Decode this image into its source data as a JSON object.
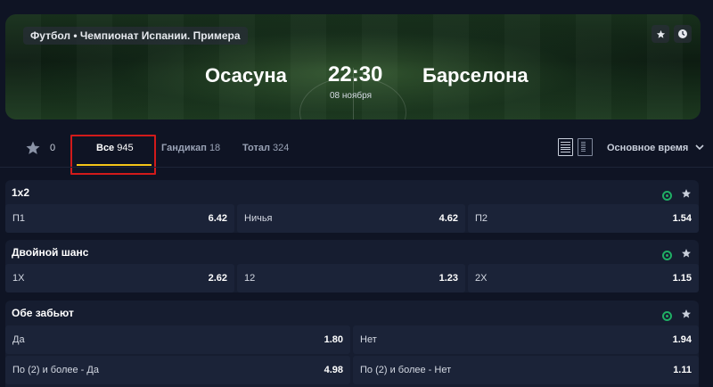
{
  "hero": {
    "breadcrumb": "Футбол • Чемпионат Испании. Примера",
    "home_team": "Осасуна",
    "away_team": "Барселона",
    "time": "22:30",
    "date": "08 ноября",
    "icons": [
      "star-icon",
      "clock-icon"
    ]
  },
  "tabs": {
    "favorites_count": "0",
    "items": [
      {
        "label": "Все",
        "count": "945"
      },
      {
        "label": "Гандикап",
        "count": "18"
      },
      {
        "label": "Тотал",
        "count": "324"
      }
    ],
    "period": "Основное время"
  },
  "markets": [
    {
      "title": "1x2",
      "outcomes": [
        {
          "name": "П1",
          "odd": "6.42"
        },
        {
          "name": "Ничья",
          "odd": "4.62"
        },
        {
          "name": "П2",
          "odd": "1.54"
        }
      ]
    },
    {
      "title": "Двойной шанс",
      "outcomes": [
        {
          "name": "1X",
          "odd": "2.62"
        },
        {
          "name": "12",
          "odd": "1.23"
        },
        {
          "name": "2X",
          "odd": "1.15"
        }
      ]
    },
    {
      "title": "Обе забьют",
      "outcomes": [
        {
          "name": "Да",
          "odd": "1.80"
        },
        {
          "name": "Нет",
          "odd": "1.94"
        },
        {
          "name": "По (2) и более - Да",
          "odd": "4.98"
        },
        {
          "name": "По (2) и более - Нет",
          "odd": "1.11"
        }
      ]
    }
  ],
  "colors": {
    "background": "#0f1424",
    "card": "#161d30",
    "outcome": "#1b2338",
    "accent_underline": "#f5c518",
    "highlight_box": "#d21a1a",
    "live_icon": "#1fae64"
  }
}
